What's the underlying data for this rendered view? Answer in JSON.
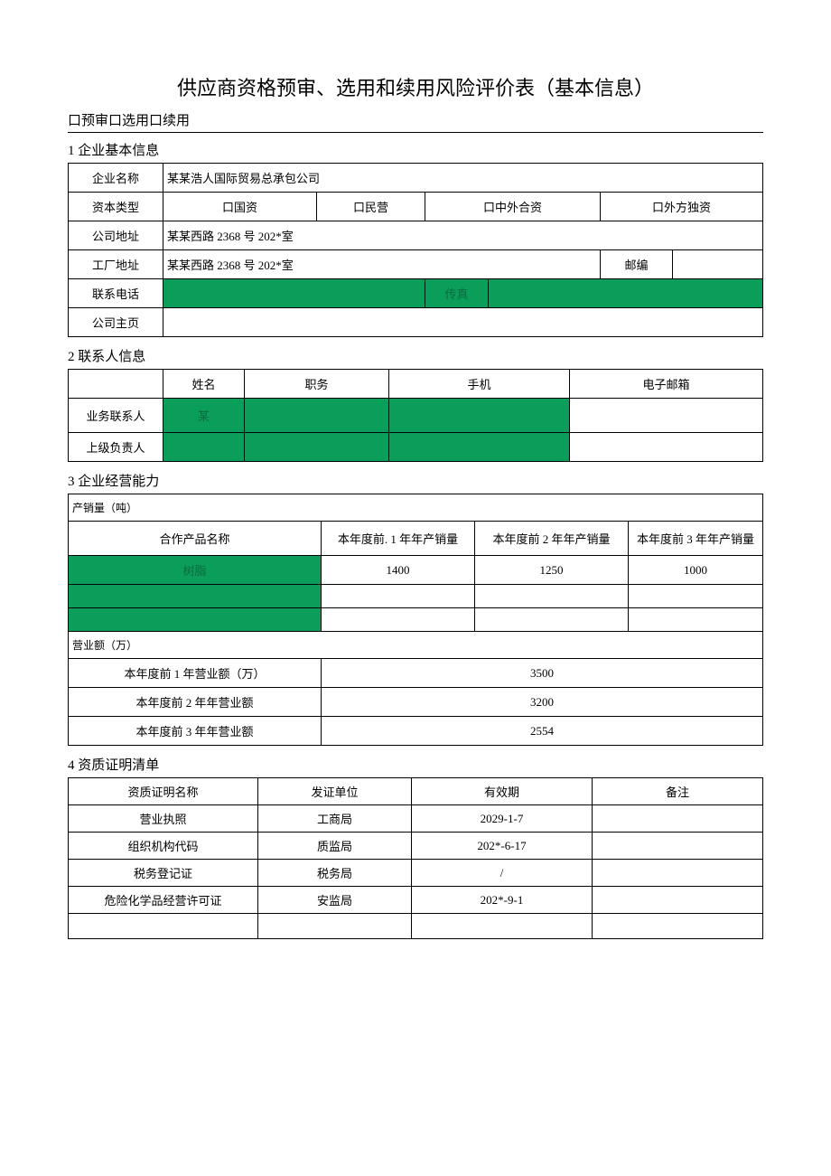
{
  "title": "供应商资格预审、选用和续用风险评价表（基本信息）",
  "checkbox_row": "口预审口选用口续用",
  "section1": {
    "head": "1 企业基本信息",
    "labels": {
      "company_name": "企业名称",
      "capital_type": "资本类型",
      "company_addr": "公司地址",
      "factory_addr": "工厂地址",
      "postcode": "邮编",
      "phone": "联系电话",
      "fax": "传真",
      "homepage": "公司主页"
    },
    "values": {
      "company_name": "某某浩人国际贸易总承包公司",
      "capital_types": {
        "c1": "口国资",
        "c2": "口民营",
        "c3": "口中外合资",
        "c4": "口外方独资"
      },
      "company_addr": "某某西路 2368 号 202*室",
      "factory_addr": "某某西路 2368 号 202*室",
      "postcode": "",
      "phone_val": "",
      "fax_val": "",
      "homepage_val": ""
    }
  },
  "section2": {
    "head": "2 联系人信息",
    "headers": {
      "name": "姓名",
      "position": "职务",
      "mobile": "手机",
      "email": "电子邮箱"
    },
    "rows": {
      "business": {
        "label": "业务联系人",
        "name": "某",
        "position": "",
        "mobile": "",
        "email": ""
      },
      "superior": {
        "label": "上级负责人",
        "name": "",
        "position": "",
        "mobile": "",
        "email": ""
      }
    }
  },
  "section3": {
    "head": "3 企业经营能力",
    "prod_label": "产销量（吨）",
    "col_headers": {
      "product": "合作产品名称",
      "y1": "本年度前. 1 年年产销量",
      "y2": "本年度前 2 年年产销量",
      "y3": "本年度前 3 年年产销量"
    },
    "rows": [
      {
        "product": "树脂",
        "y1": "1400",
        "y2": "1250",
        "y3": "1000"
      },
      {
        "product": "",
        "y1": "",
        "y2": "",
        "y3": ""
      },
      {
        "product": "",
        "y1": "",
        "y2": "",
        "y3": ""
      }
    ],
    "rev_label": "营业额（万）",
    "rev_rows": [
      {
        "label": "本年度前 1 年营业额（万）",
        "value": "3500"
      },
      {
        "label": "本年度前 2 年年营业额",
        "value": "3200"
      },
      {
        "label": "本年度前 3 年年营业额",
        "value": "2554"
      }
    ]
  },
  "section4": {
    "head": "4 资质证明清单",
    "headers": {
      "name": "资质证明名称",
      "issuer": "发证单位",
      "valid": "有效期",
      "note": "备注"
    },
    "rows": [
      {
        "name": "营业执照",
        "issuer": "工商局",
        "valid": "2029-1-7",
        "note": ""
      },
      {
        "name": "组织机构代码",
        "issuer": "质监局",
        "valid": "202*-6-17",
        "note": ""
      },
      {
        "name": "税务登记证",
        "issuer": "税务局",
        "valid": "/",
        "note": ""
      },
      {
        "name": "危险化学品经营许可证",
        "issuer": "安监局",
        "valid": "202*-9-1",
        "note": ""
      },
      {
        "name": "",
        "issuer": "",
        "valid": "",
        "note": ""
      }
    ]
  }
}
